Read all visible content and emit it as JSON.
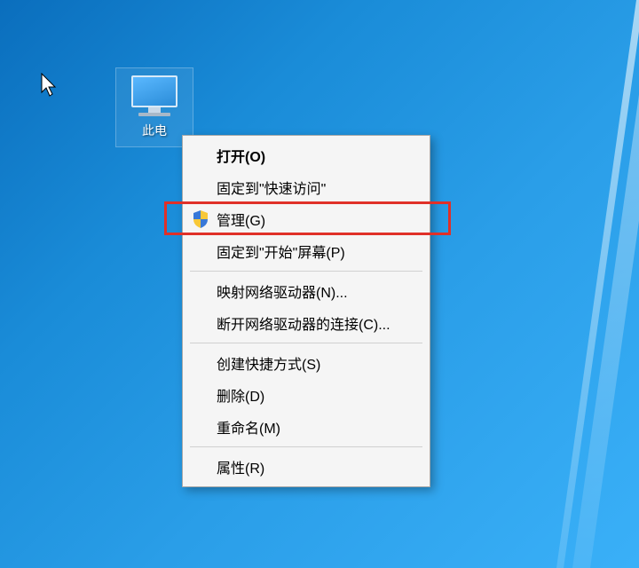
{
  "desktop_icon": {
    "label": "此电"
  },
  "context_menu": {
    "items": [
      {
        "label": "打开(O)",
        "bold": true
      },
      {
        "label": "固定到\"快速访问\""
      },
      {
        "label": "管理(G)",
        "icon": "shield",
        "highlighted": true
      },
      {
        "label": "固定到\"开始\"屏幕(P)"
      },
      {
        "separator": true
      },
      {
        "label": "映射网络驱动器(N)..."
      },
      {
        "label": "断开网络驱动器的连接(C)..."
      },
      {
        "separator": true
      },
      {
        "label": "创建快捷方式(S)"
      },
      {
        "label": "删除(D)"
      },
      {
        "label": "重命名(M)"
      },
      {
        "separator": true
      },
      {
        "label": "属性(R)"
      }
    ]
  }
}
